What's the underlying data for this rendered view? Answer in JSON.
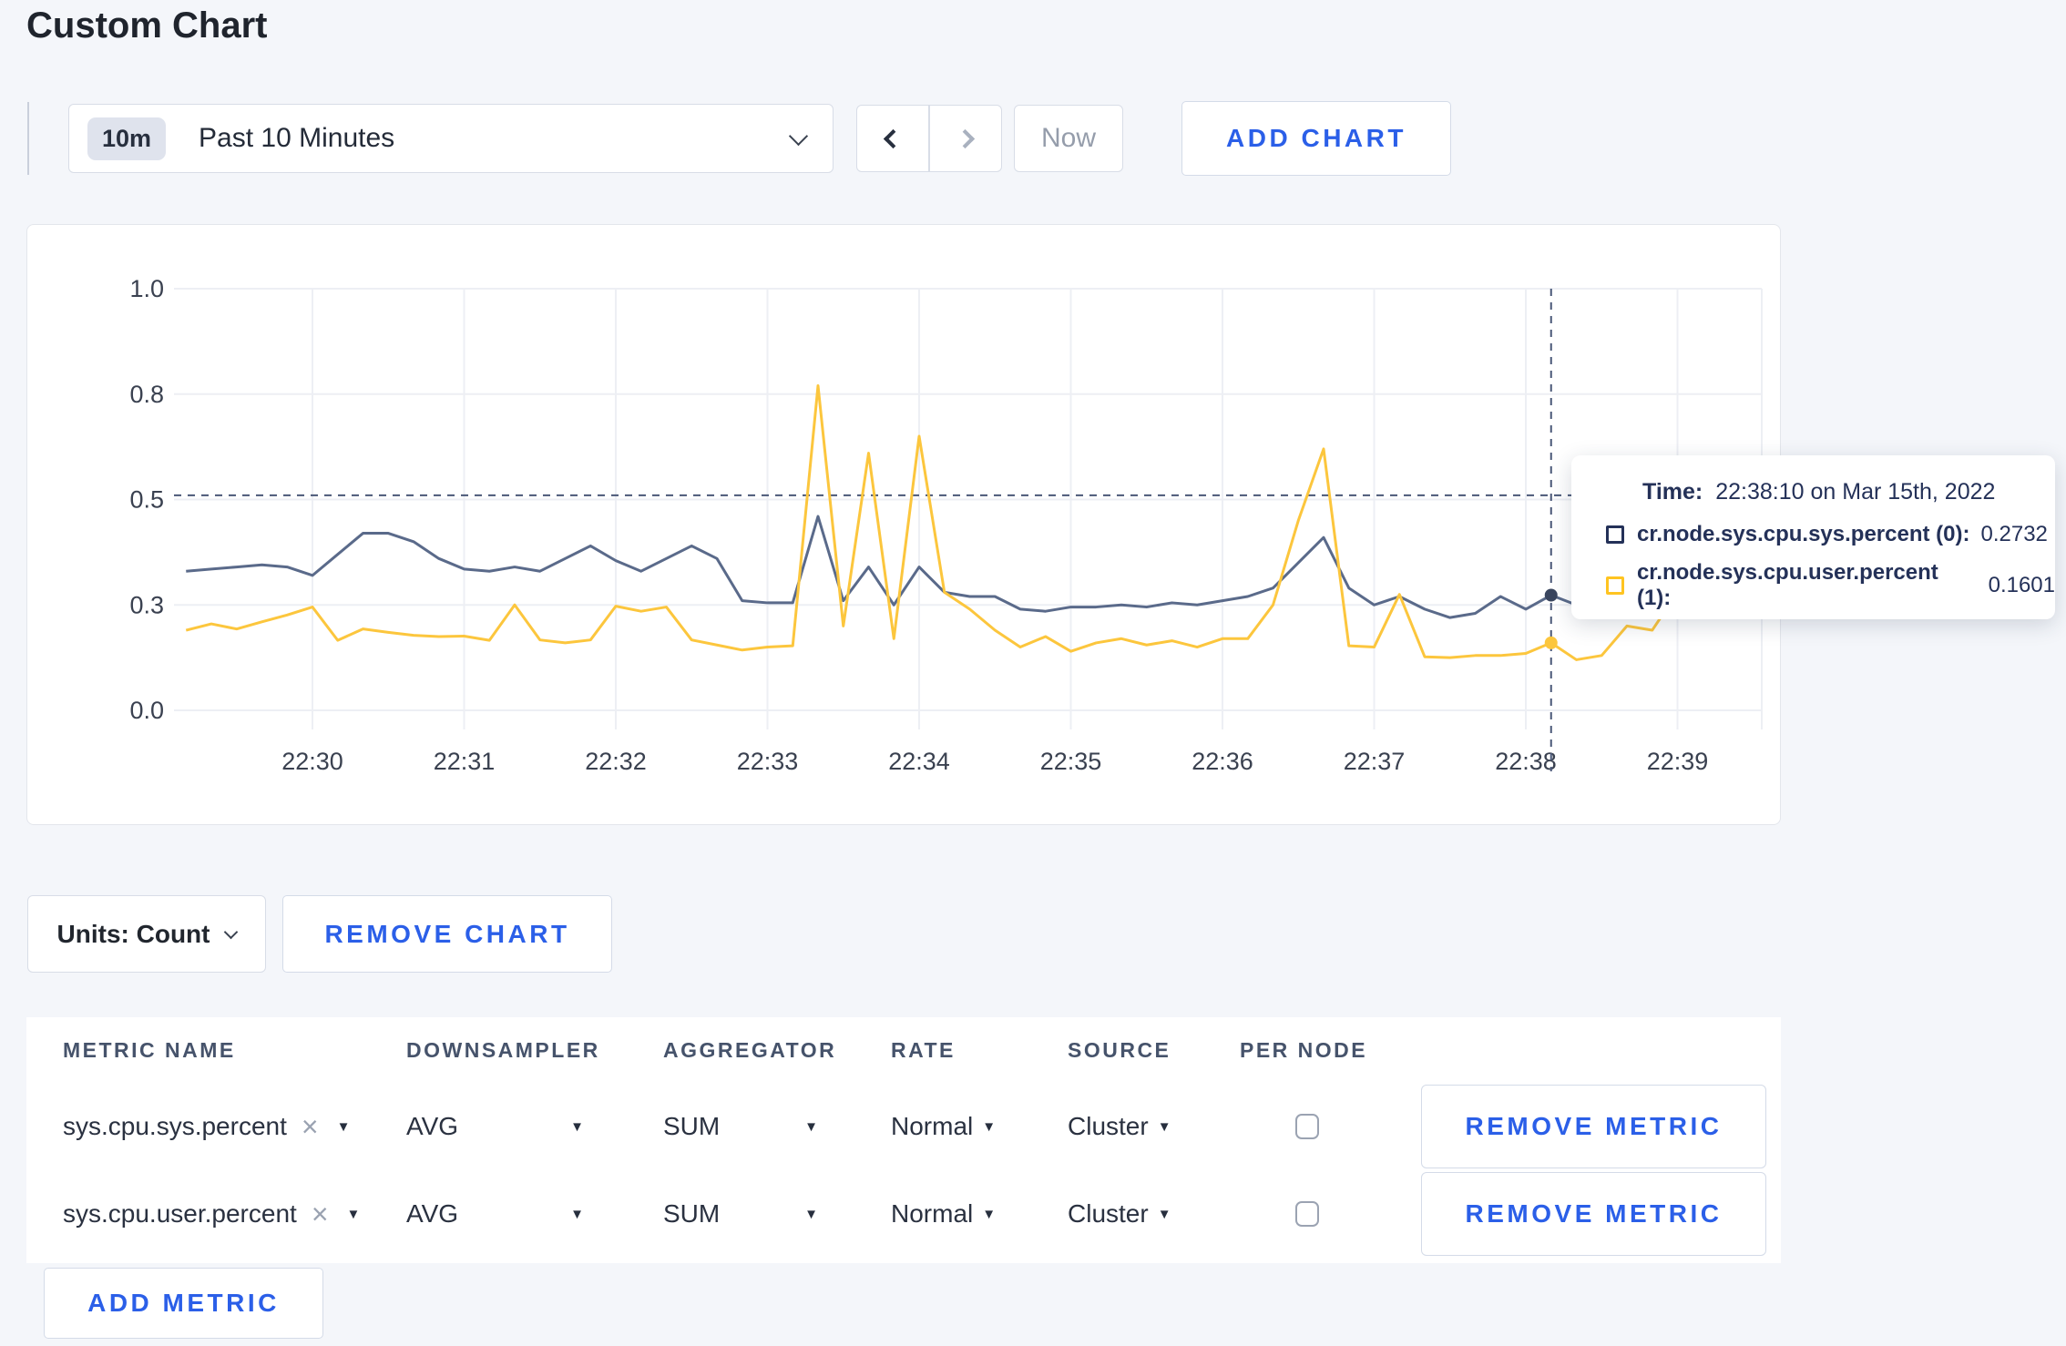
{
  "page": {
    "title": "Custom Chart",
    "bg": "#F4F6FA",
    "accent_blue": "#2B5FE8"
  },
  "toolbar": {
    "time_badge": "10m",
    "time_label": "Past 10 Minutes",
    "now_label": "Now",
    "add_chart_label": "ADD CHART"
  },
  "chart_data": {
    "type": "line",
    "title": "",
    "xlabel": "",
    "ylabel": "",
    "ylim": [
      0,
      1.0
    ],
    "grid": true,
    "y_ticks": [
      {
        "v": 1.0,
        "label": "1.0"
      },
      {
        "v": 0.75,
        "label": "0.8"
      },
      {
        "v": 0.5,
        "label": "0.5"
      },
      {
        "v": 0.25,
        "label": "0.3"
      },
      {
        "v": 0.0,
        "label": "0.0"
      }
    ],
    "x_ticks": [
      "22:30",
      "22:31",
      "22:32",
      "22:33",
      "22:34",
      "22:35",
      "22:36",
      "22:37",
      "22:38",
      "22:39"
    ],
    "x": [
      "22:29:10",
      "22:29:20",
      "22:29:30",
      "22:29:40",
      "22:29:50",
      "22:30:00",
      "22:30:10",
      "22:30:20",
      "22:30:30",
      "22:30:40",
      "22:30:50",
      "22:31:00",
      "22:31:10",
      "22:31:20",
      "22:31:30",
      "22:31:40",
      "22:31:50",
      "22:32:00",
      "22:32:10",
      "22:32:20",
      "22:32:30",
      "22:32:40",
      "22:32:50",
      "22:33:00",
      "22:33:10",
      "22:33:20",
      "22:33:30",
      "22:33:40",
      "22:33:50",
      "22:34:00",
      "22:34:10",
      "22:34:20",
      "22:34:30",
      "22:34:40",
      "22:34:50",
      "22:35:00",
      "22:35:10",
      "22:35:20",
      "22:35:30",
      "22:35:40",
      "22:35:50",
      "22:36:00",
      "22:36:10",
      "22:36:20",
      "22:36:30",
      "22:36:40",
      "22:36:50",
      "22:37:00",
      "22:37:10",
      "22:37:20",
      "22:37:30",
      "22:37:40",
      "22:37:50",
      "22:38:00",
      "22:38:10",
      "22:38:20",
      "22:38:30",
      "22:38:40",
      "22:38:50",
      "22:39:00"
    ],
    "series": [
      {
        "name": "cr.node.sys.cpu.sys.percent (0)",
        "color": "#5A6A8A",
        "values": [
          0.33,
          0.335,
          0.34,
          0.345,
          0.34,
          0.32,
          0.37,
          0.42,
          0.42,
          0.4,
          0.36,
          0.335,
          0.33,
          0.34,
          0.33,
          0.36,
          0.39,
          0.355,
          0.33,
          0.36,
          0.39,
          0.36,
          0.26,
          0.255,
          0.255,
          0.46,
          0.26,
          0.34,
          0.25,
          0.34,
          0.28,
          0.27,
          0.27,
          0.24,
          0.235,
          0.245,
          0.245,
          0.25,
          0.245,
          0.255,
          0.25,
          0.26,
          0.27,
          0.29,
          0.35,
          0.41,
          0.29,
          0.25,
          0.27,
          0.24,
          0.22,
          0.23,
          0.27,
          0.24,
          0.2732,
          0.25,
          0.28,
          0.3,
          0.29,
          0.3
        ]
      },
      {
        "name": "cr.node.sys.cpu.user.percent (1)",
        "color": "#FCC63D",
        "values": [
          0.19,
          0.205,
          0.193,
          0.21,
          0.226,
          0.245,
          0.166,
          0.193,
          0.185,
          0.178,
          0.175,
          0.176,
          0.166,
          0.25,
          0.167,
          0.16,
          0.167,
          0.247,
          0.235,
          0.245,
          0.167,
          0.155,
          0.143,
          0.15,
          0.153,
          0.77,
          0.2,
          0.61,
          0.17,
          0.65,
          0.28,
          0.24,
          0.19,
          0.15,
          0.175,
          0.14,
          0.16,
          0.17,
          0.155,
          0.165,
          0.15,
          0.17,
          0.17,
          0.25,
          0.45,
          0.62,
          0.153,
          0.15,
          0.275,
          0.127,
          0.125,
          0.13,
          0.13,
          0.135,
          0.1601,
          0.12,
          0.13,
          0.2,
          0.19,
          0.28
        ]
      }
    ],
    "hover": {
      "time": "22:38:10",
      "crosshair_value": 0.51,
      "sys_value": 0.2732,
      "user_value": 0.1601
    }
  },
  "tooltip": {
    "time_label": "Time:",
    "time_value": "22:38:10 on Mar 15th, 2022",
    "series": [
      {
        "name": "cr.node.sys.cpu.sys.percent (0):",
        "value": "0.2732",
        "swatch_color": "#243158"
      },
      {
        "name": "cr.node.sys.cpu.user.percent (1):",
        "value": "0.1601",
        "swatch_color": "#FFC421"
      }
    ]
  },
  "units_bar": {
    "units_label": "Units: Count",
    "remove_chart_label": "REMOVE CHART"
  },
  "metrics_table": {
    "headers": [
      "METRIC NAME",
      "DOWNSAMPLER",
      "AGGREGATOR",
      "RATE",
      "SOURCE",
      "PER NODE"
    ],
    "rows": [
      {
        "metric": "sys.cpu.sys.percent",
        "remove_icon": "×",
        "downsampler": "AVG",
        "aggregator": "SUM",
        "rate": "Normal",
        "source": "Cluster",
        "per_node_checked": false,
        "remove_label": "REMOVE METRIC"
      },
      {
        "metric": "sys.cpu.user.percent",
        "remove_icon": "×",
        "downsampler": "AVG",
        "aggregator": "SUM",
        "rate": "Normal",
        "source": "Cluster",
        "per_node_checked": false,
        "remove_label": "REMOVE METRIC"
      }
    ],
    "caret_icon": "▼",
    "add_metric_label": "ADD METRIC"
  }
}
